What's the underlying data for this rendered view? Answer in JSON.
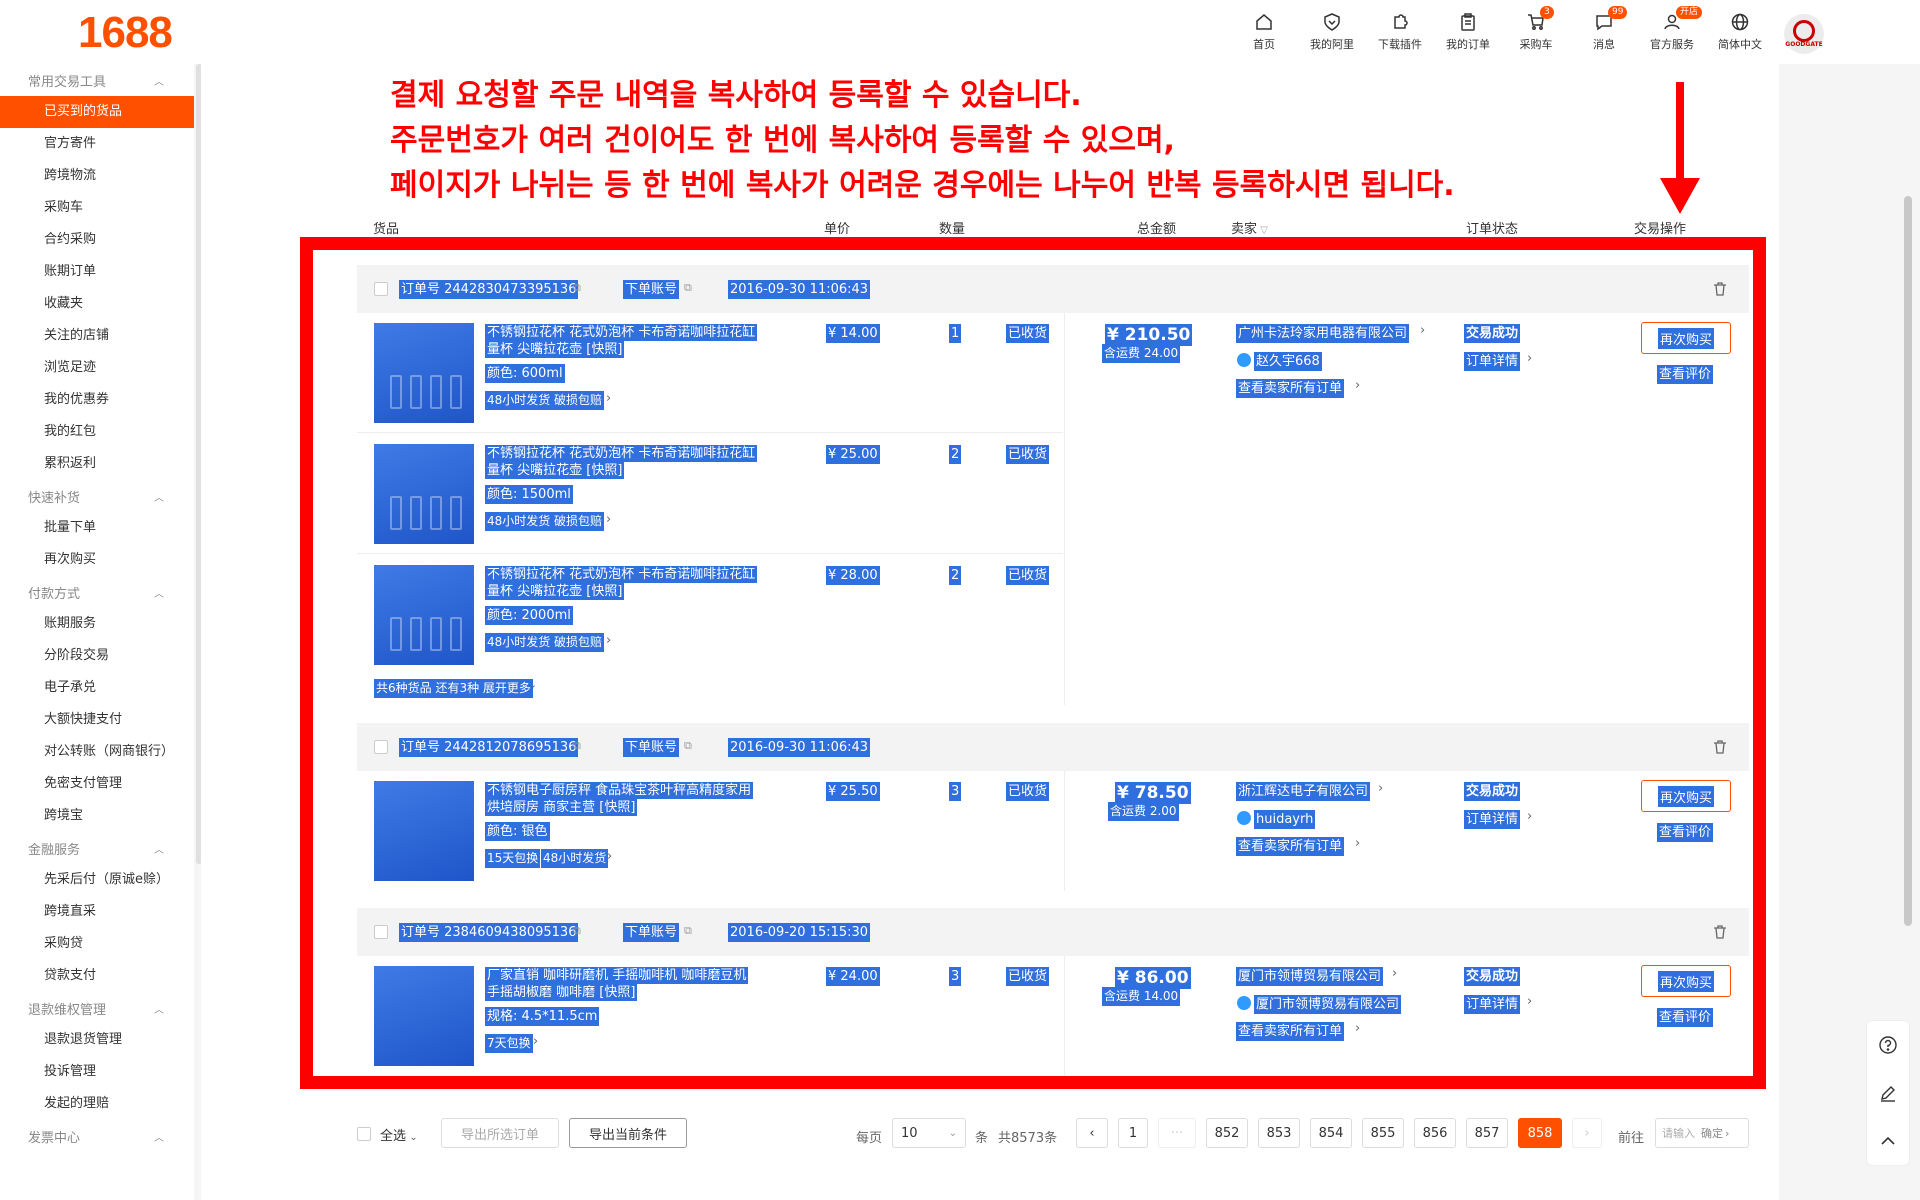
{
  "header": {
    "logo": "1688",
    "nav": [
      {
        "label": "首页",
        "icon": "home-icon"
      },
      {
        "label": "我的阿里",
        "icon": "shield-heart-icon"
      },
      {
        "label": "下载插件",
        "icon": "puzzle-icon"
      },
      {
        "label": "我的订单",
        "icon": "clipboard-icon"
      },
      {
        "label": "采购车",
        "icon": "cart-icon",
        "badge": "3"
      },
      {
        "label": "消息",
        "icon": "message-icon",
        "badge": "99"
      },
      {
        "label": "官方服务",
        "icon": "user-service-icon",
        "badge": "开店"
      },
      {
        "label": "简体中文",
        "icon": "globe-icon"
      }
    ],
    "avatar_text": "GOODGATE"
  },
  "sidebar": {
    "groups": [
      {
        "title": "常用交易工具",
        "items": [
          "已买到的货品",
          "官方寄件",
          "跨境物流",
          "采购车",
          "合约采购",
          "账期订单",
          "收藏夹",
          "关注的店铺",
          "浏览足迹",
          "我的优惠券",
          "我的红包",
          "累积返利"
        ]
      },
      {
        "title": "快速补货",
        "items": [
          "批量下单",
          "再次购买"
        ]
      },
      {
        "title": "付款方式",
        "items": [
          "账期服务",
          "分阶段交易",
          "电子承兑",
          "大额快捷支付",
          "对公转账（网商银行）",
          "免密支付管理",
          "跨境宝"
        ]
      },
      {
        "title": "金融服务",
        "items": [
          "先采后付（原诚e赊）",
          "跨境直采",
          "采购贷",
          "贷款支付"
        ]
      },
      {
        "title": "退款维权管理",
        "items": [
          "退款退货管理",
          "投诉管理",
          "发起的理赔"
        ]
      },
      {
        "title": "发票中心",
        "items": []
      }
    ],
    "active_item": "已买到的货品"
  },
  "annotation": {
    "line1": "결제 요청할 주문 내역을 복사하여 등록할 수 있습니다.",
    "line2": "주문번호가 여러 건이어도 한 번에 복사하여 등록할 수 있으며,",
    "line3": "페이지가 나뉘는 등 한 번에 복사가 어려운 경우에는 나누어 반복 등록하시면 됩니다."
  },
  "columns": {
    "goods": "货品",
    "price": "单价",
    "qty": "数量",
    "total": "总金额",
    "seller": "卖家",
    "status": "订单状态",
    "action": "交易操作"
  },
  "orders": [
    {
      "order_no": "订单号 2442830473395136",
      "account": "下单账号",
      "time": "2016-09-30 11:06:43",
      "items": [
        {
          "title1": "不锈钢拉花杯 花式奶泡杯 卡布奇诺咖啡拉花缸",
          "title2": "量杯 尖嘴拉花壶 [快照]",
          "spec": "颜色: 600ml",
          "tag1": "48小时发货",
          "tag2": "破损包赔",
          "price": "¥ 14.00",
          "qty": "1",
          "ship": "已收货"
        },
        {
          "title1": "不锈钢拉花杯 花式奶泡杯 卡布奇诺咖啡拉花缸",
          "title2": "量杯 尖嘴拉花壶 [快照]",
          "spec": "颜色: 1500ml",
          "tag1": "48小时发货",
          "tag2": "破损包赔",
          "price": "¥ 25.00",
          "qty": "2",
          "ship": "已收货"
        },
        {
          "title1": "不锈钢拉花杯 花式奶泡杯 卡布奇诺咖啡拉花缸",
          "title2": "量杯 尖嘴拉花壶 [快照]",
          "spec": "颜色: 2000ml",
          "tag1": "48小时发货",
          "tag2": "破损包赔",
          "price": "¥ 28.00",
          "qty": "2",
          "ship": "已收货"
        }
      ],
      "more": "共6种货品 还有3种 展开更多",
      "total": "¥ 210.50",
      "shipping": "含运费 24.00",
      "seller": "广州卡法玲家用电器有限公司",
      "contact": "赵久宇668",
      "seller_orders": "查看卖家所有订单",
      "status": "交易成功",
      "detail": "订单详情",
      "rebuy": "再次购买",
      "review": "查看评价"
    },
    {
      "order_no": "订单号 2442812078695136",
      "account": "下单账号",
      "time": "2016-09-30 11:06:43",
      "items": [
        {
          "title1": "不锈钢电子厨房秤 食品珠宝茶叶秤高精度家用",
          "title2": "烘培厨房 商家主营 [快照]",
          "spec": "颜色: 银色",
          "tag1": "15天包换",
          "tag2": "48小时发货",
          "price": "¥ 25.50",
          "qty": "3",
          "ship": "已收货"
        }
      ],
      "total": "¥ 78.50",
      "shipping": "含运费 2.00",
      "seller": "浙江辉达电子有限公司",
      "contact": "huidayrh",
      "seller_orders": "查看卖家所有订单",
      "status": "交易成功",
      "detail": "订单详情",
      "rebuy": "再次购买",
      "review": "查看评价"
    },
    {
      "order_no": "订单号 2384609438095136",
      "account": "下单账号",
      "time": "2016-09-20 15:15:30",
      "items": [
        {
          "title1": "厂家直销 咖啡研磨机 手摇咖啡机 咖啡磨豆机",
          "title2": "手摇胡椒磨 咖啡磨 [快照]",
          "spec": "规格: 4.5*11.5cm",
          "tag1": "7天包换",
          "tag2": "",
          "price": "¥ 24.00",
          "qty": "3",
          "ship": "已收货"
        }
      ],
      "total": "¥ 86.00",
      "shipping": "含运费 14.00",
      "seller": "厦门市领博贸易有限公司",
      "contact": "厦门市领博贸易有限公司",
      "seller_orders": "查看卖家所有订单",
      "status": "交易成功",
      "detail": "订单详情",
      "rebuy": "再次购买",
      "review": "查看评价"
    }
  ],
  "footer": {
    "select_all": "全选",
    "export_selected": "导出所选订单",
    "export_current": "导出当前条件",
    "per_page_label": "每页",
    "per_page_value": "10",
    "unit": "条",
    "total_count": "共8573条",
    "pages": [
      "1",
      "···",
      "852",
      "853",
      "854",
      "855",
      "856",
      "857",
      "858"
    ],
    "active_page": "858",
    "goto_label": "前往",
    "goto_placeholder": "请输入",
    "confirm": "确定"
  },
  "colors": {
    "brand": "#ff5000",
    "selection": "#2f6fde",
    "annotation": "#ff0000"
  }
}
